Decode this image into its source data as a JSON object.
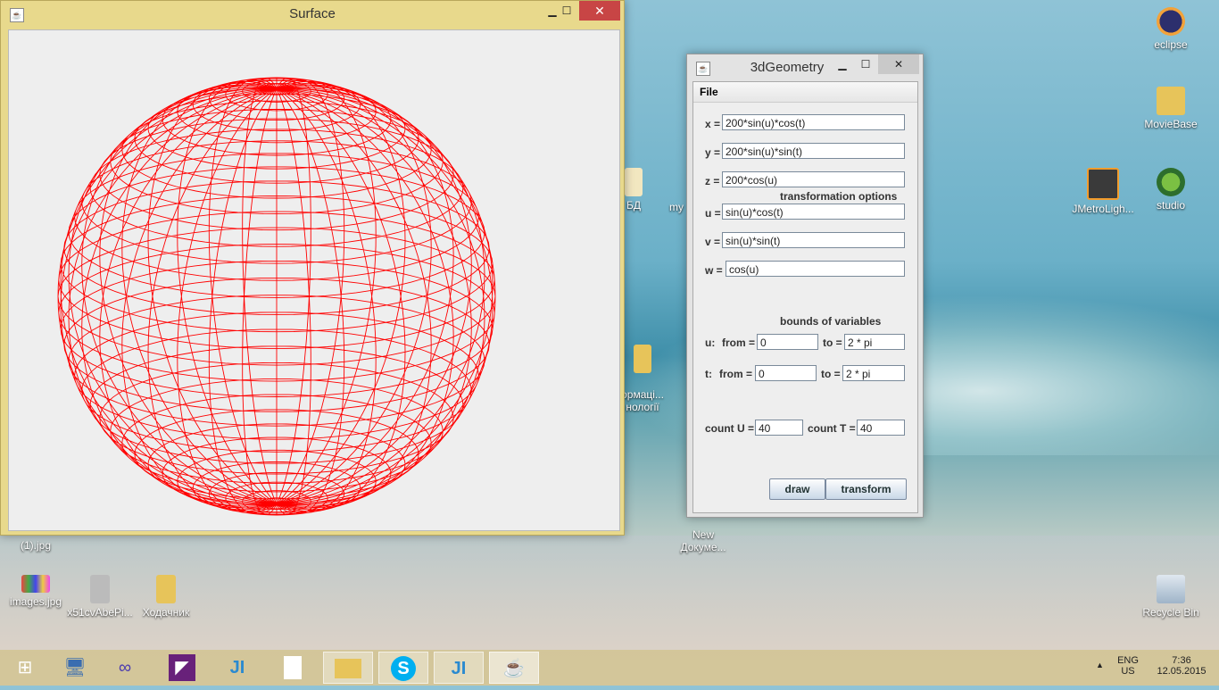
{
  "desktop": {
    "icons": [
      {
        "label": "eclipse",
        "icon": "eclipse-icon"
      },
      {
        "label": "MovieBase",
        "icon": "folder-icon"
      },
      {
        "label": "JMetroLigh...",
        "icon": "sublime-icon"
      },
      {
        "label": "studio",
        "icon": "android-studio-icon"
      },
      {
        "label": "Recycle Bin",
        "icon": "recycle-bin-icon"
      },
      {
        "label": "БД",
        "icon": "document-icon"
      },
      {
        "label": "my",
        "icon": "file-icon"
      },
      {
        "label": "ормаці...\nнології",
        "icon": "folder-icon"
      },
      {
        "label": "New\nДокуме...",
        "icon": "document-icon"
      },
      {
        "label": "(1).jpg",
        "icon": "image-icon"
      },
      {
        "label": "images.jpg",
        "icon": "image-icon"
      },
      {
        "label": "x51cvAbePi...",
        "icon": "image-icon"
      },
      {
        "label": "Ходачник",
        "icon": "folder-icon"
      }
    ]
  },
  "surface_window": {
    "title": "Surface",
    "minimize": "▁",
    "maximize": "☐",
    "close": "✕",
    "wire_color": "#ff0000"
  },
  "geometry_window": {
    "title": "3dGeometry",
    "minimize": "▁",
    "maximize": "☐",
    "close": "✕",
    "menu": {
      "file": "File"
    },
    "fields": {
      "x_label": "x =",
      "x_value": "200*sin(u)*cos(t)",
      "y_label": "y =",
      "y_value": "200*sin(u)*sin(t)",
      "z_label": "z =",
      "z_value": "200*cos(u)",
      "transform_heading": "transformation options",
      "u_label": "u =",
      "u_value": "sin(u)*cos(t)",
      "v_label": "v =",
      "v_value": "sin(u)*sin(t)",
      "w_label": "w =",
      "w_value": "cos(u)",
      "bounds_heading": "bounds of variables",
      "u_bound_label": "u:",
      "u_from_label": "from =",
      "u_from": "0",
      "u_to_label": "to =",
      "u_to": "2 * pi",
      "t_bound_label": "t:",
      "t_from_label": "from =",
      "t_from": "0",
      "t_to_label": "to =",
      "t_to": "2 * pi",
      "count_u_label": "count U =",
      "count_u": "40",
      "count_t_label": "count T =",
      "count_t": "40"
    },
    "buttons": {
      "draw": "draw",
      "transform": "transform"
    }
  },
  "taskbar": {
    "items": [
      {
        "name": "start",
        "icon": "windows-logo-icon"
      },
      {
        "name": "computer",
        "icon": "computer-icon"
      },
      {
        "name": "infinity-app",
        "icon": "infinity-icon"
      },
      {
        "name": "visual-studio",
        "icon": "visual-studio-icon"
      },
      {
        "name": "intellij-1",
        "icon": "intellij-icon"
      },
      {
        "name": "document",
        "icon": "blank-document-icon"
      },
      {
        "name": "file-explorer",
        "icon": "folder-icon"
      },
      {
        "name": "skype",
        "icon": "skype-icon"
      },
      {
        "name": "intellij-2",
        "icon": "intellij-icon"
      },
      {
        "name": "java",
        "icon": "java-icon"
      }
    ],
    "language": "ENG",
    "region": "US",
    "time": "7:36",
    "date": "12.05.2015"
  }
}
